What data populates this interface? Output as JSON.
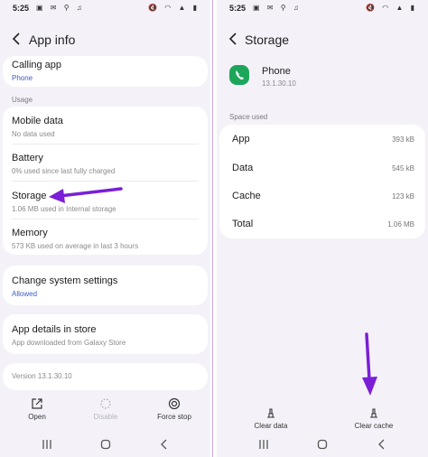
{
  "left": {
    "status": {
      "time": "5:25",
      "notif_icons": "▣ ✉ ⚲ ♫",
      "sys_icons": "🔇 ◠ ▲ ▮"
    },
    "header": {
      "title": "App info"
    },
    "calling_app": {
      "label": "Calling app",
      "value": "Phone"
    },
    "usage_label": "Usage",
    "usage": [
      {
        "label": "Mobile data",
        "sub": "No data used"
      },
      {
        "label": "Battery",
        "sub": "0% used since last fully charged"
      },
      {
        "label": "Storage",
        "sub": "1.06 MB used in Internal storage"
      },
      {
        "label": "Memory",
        "sub": "573 KB used on average in last 3 hours"
      }
    ],
    "system_settings": {
      "label": "Change system settings",
      "value": "Allowed"
    },
    "store": {
      "label": "App details in store",
      "sub": "App downloaded from Galaxy Store"
    },
    "version": "Version 13.1.30.10",
    "actions": {
      "open": "Open",
      "disable": "Disable",
      "force_stop": "Force stop"
    }
  },
  "right": {
    "status": {
      "time": "5:25",
      "notif_icons": "▣ ✉ ⚲ ♫",
      "sys_icons": "🔇 ◠ ▲ ▮"
    },
    "header": {
      "title": "Storage"
    },
    "app": {
      "name": "Phone",
      "version": "13.1.30.10"
    },
    "space_label": "Space used",
    "rows": [
      {
        "label": "App",
        "value": "393 kB"
      },
      {
        "label": "Data",
        "value": "545 kB"
      },
      {
        "label": "Cache",
        "value": "123 kB"
      },
      {
        "label": "Total",
        "value": "1.06 MB"
      }
    ],
    "actions": {
      "clear_data": "Clear data",
      "clear_cache": "Clear cache"
    }
  },
  "colors": {
    "accent_purple": "#7a1fd6",
    "link_blue": "#3b5cc9",
    "app_green": "#1da65a",
    "background": "#f4f2f8"
  },
  "icons": [
    "back-arrow-icon",
    "open-icon",
    "disable-icon",
    "force-stop-icon",
    "clear-data-icon",
    "clear-cache-icon",
    "recents-icon",
    "home-icon",
    "back-nav-icon",
    "phone-app-icon"
  ]
}
